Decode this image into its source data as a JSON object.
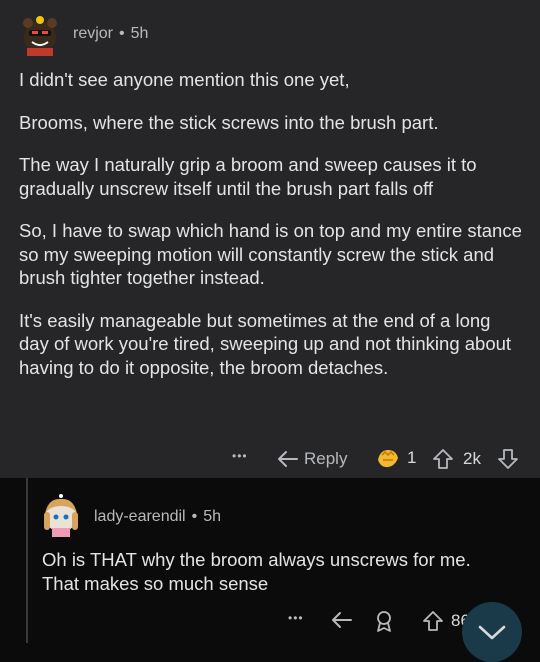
{
  "comment": {
    "username": "revjor",
    "separator": "•",
    "age": "5h",
    "paragraphs": [
      "I didn't see anyone mention this one yet,",
      "Brooms, where the stick screws into the brush part.",
      "The way I naturally grip a broom and sweep causes it to gradually unscrew itself until the brush part falls off",
      "So, I have to swap which hand is on top and my entire stance so my sweeping motion will constantly screw the stick and brush tighter together instead.",
      "It's easily manageable but sometimes at the end of a long day of work you're tired,  sweeping up and not thinking about having to do it opposite, the broom detaches."
    ],
    "actions": {
      "more": "•••",
      "reply_label": "Reply",
      "award_count": "1",
      "vote_count": "2k"
    }
  },
  "reply": {
    "username": "lady-earendil",
    "separator": "•",
    "age": "5h",
    "text": "Oh is THAT why the broom always unscrews for me. That makes so much sense",
    "actions": {
      "more": "•••",
      "vote_count": "86"
    }
  },
  "colors": {
    "comment_bg": "#262629",
    "page_bg": "#0b0b0b",
    "text": "#e2e4e6",
    "meta": "#b7babd",
    "award": "#f5b92e"
  }
}
